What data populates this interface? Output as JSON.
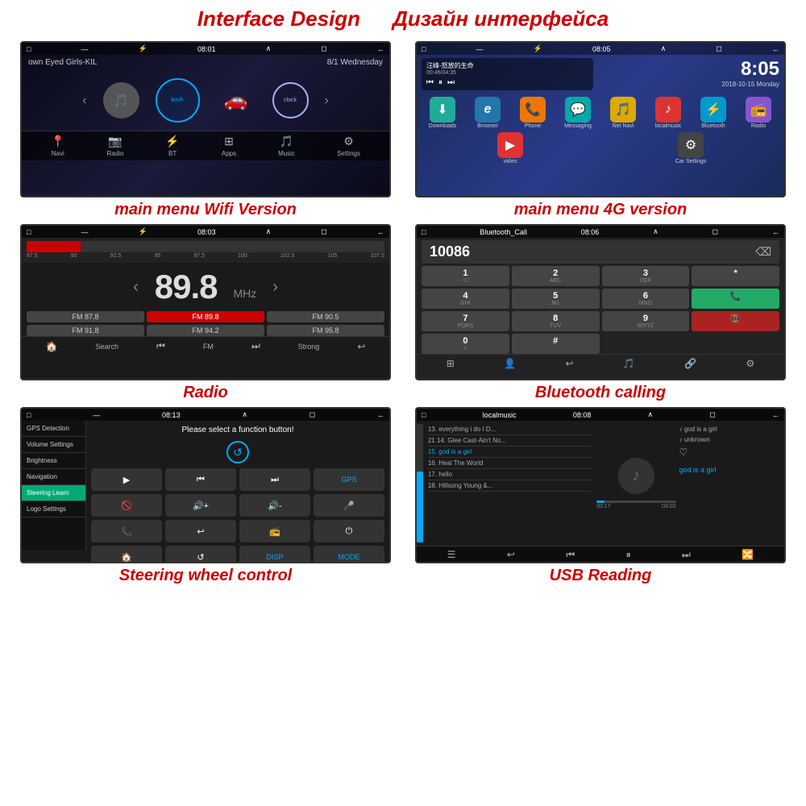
{
  "page": {
    "header": {
      "title_en": "Interface Design",
      "title_ru": "Дизайн интерфейса"
    },
    "screens": {
      "s1": {
        "caption": "main menu Wifi Version",
        "status": "08:01",
        "song": "own Eyed Girls-KIL",
        "date": "8/1 Wednesday",
        "speed": "km/h",
        "nav_items": [
          "Navi",
          "Radio",
          "BT",
          "Apps",
          "Music",
          "Settings"
        ]
      },
      "s2": {
        "caption": "main menu 4G version",
        "status": "08:05",
        "music_title": "汪峰-怒放的生命",
        "music_time": "00:46/04:35",
        "time_big": "8:05",
        "date_small": "2018-10-15 Monday",
        "icons": [
          {
            "label": "Downloads",
            "bg": "green",
            "symbol": "⬇"
          },
          {
            "label": "Browser",
            "bg": "blue",
            "symbol": "e"
          },
          {
            "label": "Phone",
            "bg": "orange",
            "symbol": "📞"
          },
          {
            "label": "Messaging",
            "bg": "teal",
            "symbol": "💬"
          },
          {
            "label": "Net Navi",
            "bg": "yellow",
            "symbol": "🎵"
          },
          {
            "label": "localmusic",
            "bg": "red",
            "symbol": "🎵"
          },
          {
            "label": "Bluetooth",
            "bg": "blue",
            "symbol": "⚡"
          },
          {
            "label": "Radio",
            "bg": "cyan",
            "symbol": "📻"
          },
          {
            "label": "video",
            "bg": "red",
            "symbol": "▶"
          },
          {
            "label": "Car Settings",
            "bg": "dk",
            "symbol": "⚙"
          }
        ]
      },
      "s3": {
        "caption": "Radio",
        "status": "08:03",
        "current_freq": "89.8",
        "mhz": "MHz",
        "freq_labels": [
          "87.5",
          "90",
          "92.5",
          "95",
          "97.5",
          "100",
          "102.5",
          "105",
          "107.5"
        ],
        "presets": [
          {
            "label": "FM 87.8",
            "active": false
          },
          {
            "label": "FM 89.8",
            "active": true
          },
          {
            "label": "FM 90.5",
            "active": false
          },
          {
            "label": "FM 91.8",
            "active": false
          },
          {
            "label": "FM 94.2",
            "active": false
          },
          {
            "label": "FM 95.8",
            "active": false
          }
        ],
        "fm_label": "FM",
        "bottom_btns": [
          "🏠",
          "Search",
          "⏮",
          "FM",
          "⏭",
          "Strong",
          "↩"
        ]
      },
      "s4": {
        "caption": "Bluetooth calling",
        "status": "08:06",
        "bt_label": "Bluetooth_Call",
        "number": "10086",
        "keys": [
          {
            "main": "1",
            "sub": "○□"
          },
          {
            "main": "2",
            "sub": "ABC"
          },
          {
            "main": "3",
            "sub": "DEF"
          },
          {
            "main": "*",
            "sub": ""
          },
          {
            "main": "4",
            "sub": "GHI"
          },
          {
            "main": "5",
            "sub": "JKL"
          },
          {
            "main": "6",
            "sub": "MNO"
          },
          {
            "main": "0",
            "sub": "+"
          },
          {
            "main": "7",
            "sub": "PQRS"
          },
          {
            "main": "8",
            "sub": "TUV"
          },
          {
            "main": "9",
            "sub": "WXYZ"
          },
          {
            "main": "#",
            "sub": ""
          }
        ],
        "call_btn": "📞",
        "end_btn": "📵"
      },
      "s5": {
        "caption": "Steering wheel control",
        "status": "08:13",
        "prompt": "Please select a function button!",
        "sidebar_items": [
          {
            "label": "GPS Detection",
            "active": false
          },
          {
            "label": "Volume Settings",
            "active": false
          },
          {
            "label": "Brightness",
            "active": false
          },
          {
            "label": "Navigation",
            "active": false
          },
          {
            "label": "Steering Learn",
            "active": true
          },
          {
            "label": "Logo Settings",
            "active": false
          }
        ],
        "buttons": [
          {
            "symbol": "▶",
            "label": ""
          },
          {
            "symbol": "⏮",
            "label": ""
          },
          {
            "symbol": "⏭",
            "label": ""
          },
          {
            "symbol": "GPS",
            "label": "GPS"
          },
          {
            "symbol": "🚫",
            "label": ""
          },
          {
            "symbol": "🔊+",
            "label": ""
          },
          {
            "symbol": "🔊-",
            "label": ""
          },
          {
            "symbol": "🎤",
            "label": ""
          },
          {
            "symbol": "📞",
            "label": ""
          },
          {
            "symbol": "↩",
            "label": ""
          },
          {
            "symbol": "📻",
            "label": ""
          },
          {
            "symbol": "⏻",
            "label": ""
          },
          {
            "symbol": "🏠",
            "label": ""
          },
          {
            "symbol": "↺",
            "label": ""
          },
          {
            "symbol": "DISP",
            "label": "DISP"
          },
          {
            "symbol": "MODE",
            "label": "MODE"
          }
        ]
      },
      "s6": {
        "caption": "USB Reading",
        "status": "08:08",
        "tracks": [
          {
            "num": "",
            "title": "13. everything i do I D...",
            "active": false
          },
          {
            "num": "21",
            "title": "14. Glee Cast-Ain't No...",
            "active": false
          },
          {
            "num": "",
            "title": "15. god is a girl",
            "active": true
          },
          {
            "num": "",
            "title": "16. Heal The World",
            "active": false
          },
          {
            "num": "",
            "title": "17. hello",
            "active": false
          },
          {
            "num": "",
            "title": "18. Hillsong Young &...",
            "active": false
          }
        ],
        "right_items": [
          {
            "text": "♪ god is a girl"
          },
          {
            "text": "♪ unknown"
          },
          {
            "text": "♡"
          }
        ],
        "song_title": "god is a girl",
        "time_current": "00:17",
        "time_total": "03:02",
        "bottom_icons": [
          "☰",
          "↩",
          "⏮",
          "⏸",
          "⏭",
          "🔀"
        ]
      }
    }
  }
}
